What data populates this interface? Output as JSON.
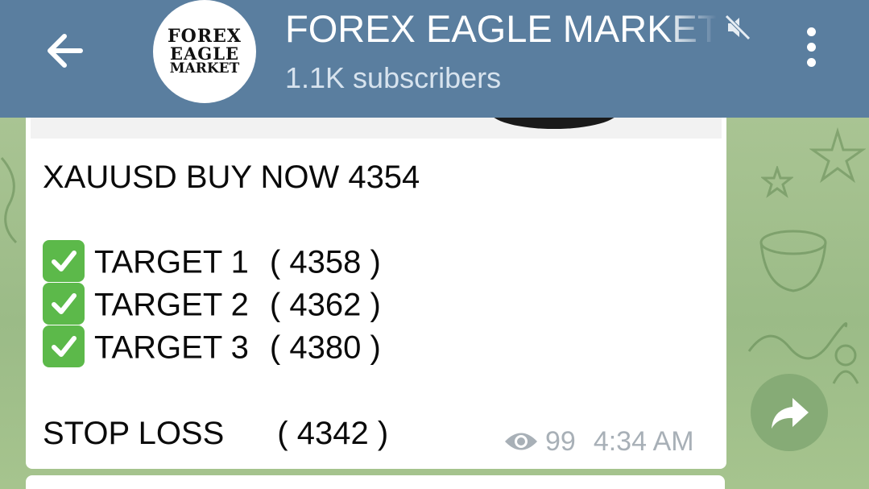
{
  "header": {
    "back_icon": "arrow-left-icon",
    "avatar_lines": [
      "FOREX",
      "EAGLE",
      "MARKET"
    ],
    "title": "FOREX EAGLE MARKET",
    "mute_icon": "muted-speaker-icon",
    "subscribers": "1.1K subscribers",
    "menu_icon": "vertical-dots-icon",
    "background_color": "#5a7e9f"
  },
  "message": {
    "headline": "XAUUSD BUY NOW 4354",
    "targets": [
      {
        "label": "TARGET 1",
        "value": "( 4358  )",
        "icon": "check-mark-icon"
      },
      {
        "label": "TARGET 2",
        "value": "( 4362  )",
        "icon": "check-mark-icon"
      },
      {
        "label": "TARGET 3",
        "value": "( 4380  )",
        "icon": "check-mark-icon"
      }
    ],
    "stop_loss_label": "STOP LOSS",
    "stop_loss_value": "( 4342 )",
    "views_icon": "eye-icon",
    "views": "99",
    "time": "4:34 AM"
  },
  "forward_icon": "forward-share-icon",
  "colors": {
    "check_green": "#5cb94a",
    "chat_background": "#9dbb8c",
    "meta_gray": "#a8b0b7"
  }
}
